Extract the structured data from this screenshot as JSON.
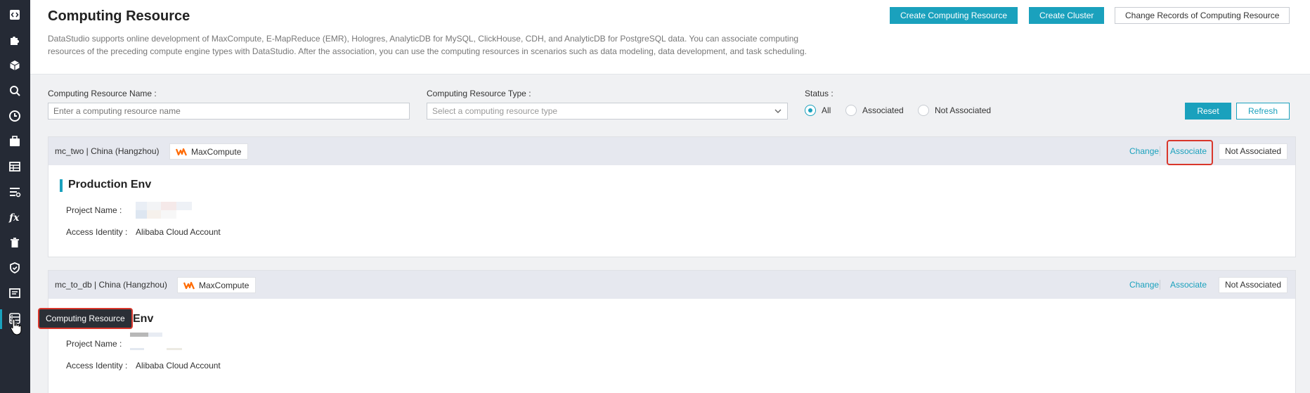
{
  "sidebar": {
    "icons": [
      "code-icon",
      "puzzle-icon",
      "cube-icon",
      "search-icon",
      "clock-icon",
      "briefcase-icon",
      "table-icon",
      "list-icon",
      "fx-icon",
      "trash-icon",
      "shield-icon",
      "document-icon",
      "database-icon"
    ],
    "tooltip": "Computing Resource"
  },
  "header": {
    "title": "Computing Resource",
    "description": "DataStudio supports online development of MaxCompute, E-MapReduce (EMR), Hologres, AnalyticDB for MySQL, ClickHouse, CDH, and AnalyticDB for PostgreSQL data. You can associate computing resources of the preceding compute engine types with DataStudio. After the association, you can use the computing resources in scenarios such as data modeling, data development, and task scheduling.",
    "buttons": {
      "create_resource": "Create Computing Resource",
      "create_cluster": "Create Cluster",
      "change_records": "Change Records of Computing Resource"
    }
  },
  "filters": {
    "name_label": "Computing Resource Name :",
    "name_placeholder": "Enter a computing resource name",
    "type_label": "Computing Resource Type :",
    "type_placeholder": "Select a computing resource type",
    "status_label": "Status :",
    "status_options": [
      "All",
      "Associated",
      "Not Associated"
    ],
    "status_selected": "All",
    "reset": "Reset",
    "refresh": "Refresh"
  },
  "cards": [
    {
      "name": "mc_two | China (Hangzhou)",
      "engine": "MaxCompute",
      "change": "Change",
      "associate": "Associate",
      "status": "Not Associated",
      "env_title": "Production Env",
      "project_label": "Project Name :",
      "identity_label": "Access Identity :",
      "identity_value": "Alibaba Cloud Account"
    },
    {
      "name": "mc_to_db | China (Hangzhou)",
      "engine": "MaxCompute",
      "change": "Change",
      "associate": "Associate",
      "status": "Not Associated",
      "env_title": "Env",
      "project_label": "Project Name :",
      "identity_label": "Access Identity :",
      "identity_value": "Alibaba Cloud Account"
    }
  ],
  "colors": {
    "accent": "#1aa1bd",
    "sidebar": "#252a35",
    "highlight": "#d9362b",
    "engine_logo": "#ff6a00"
  }
}
